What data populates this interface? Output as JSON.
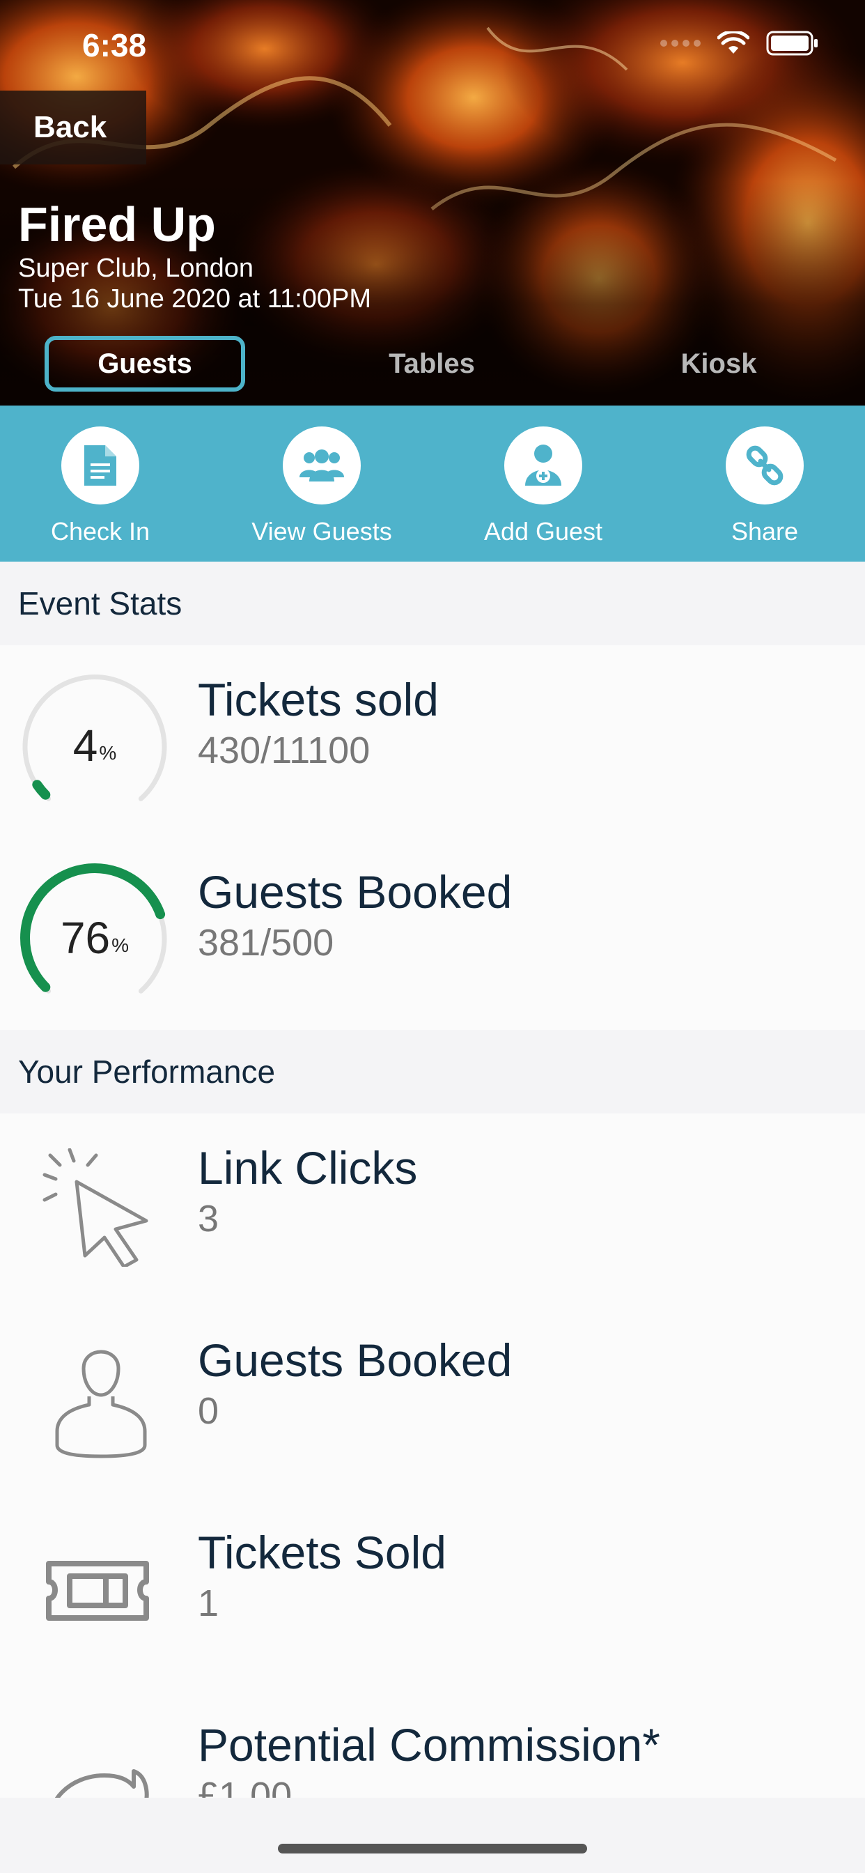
{
  "status_bar": {
    "time": "6:38"
  },
  "nav": {
    "back_label": "Back"
  },
  "event": {
    "title": "Fired Up",
    "venue": "Super Club, London",
    "datetime": "Tue 16 June 2020 at 11:00PM"
  },
  "tabs": [
    {
      "label": "Guests",
      "active": true
    },
    {
      "label": "Tables",
      "active": false
    },
    {
      "label": "Kiosk",
      "active": false
    }
  ],
  "actions": [
    {
      "label": "Check In",
      "icon": "document-icon"
    },
    {
      "label": "View Guests",
      "icon": "group-icon"
    },
    {
      "label": "Add Guest",
      "icon": "add-user-icon"
    },
    {
      "label": "Share",
      "icon": "link-icon"
    }
  ],
  "event_stats": {
    "heading": "Event Stats",
    "items": [
      {
        "title": "Tickets sold",
        "value": "430/11100",
        "percent": "4",
        "percent_sign": "%"
      },
      {
        "title": "Guests Booked",
        "value": "381/500",
        "percent": "76",
        "percent_sign": "%"
      }
    ]
  },
  "performance": {
    "heading": "Your Performance",
    "items": [
      {
        "title": "Link Clicks",
        "value": "3",
        "icon": "cursor-click-icon"
      },
      {
        "title": "Guests Booked",
        "value": "0",
        "icon": "person-icon"
      },
      {
        "title": "Tickets Sold",
        "value": "1",
        "icon": "ticket-icon"
      },
      {
        "title": "Potential Commission*",
        "value": "£1.00",
        "icon": "piggy-bank-icon"
      }
    ]
  },
  "colors": {
    "accent": "#4fb3cb",
    "gauge_fill": "#16904e",
    "gauge_track": "#e3e3e3",
    "text_dark": "#13283c"
  }
}
